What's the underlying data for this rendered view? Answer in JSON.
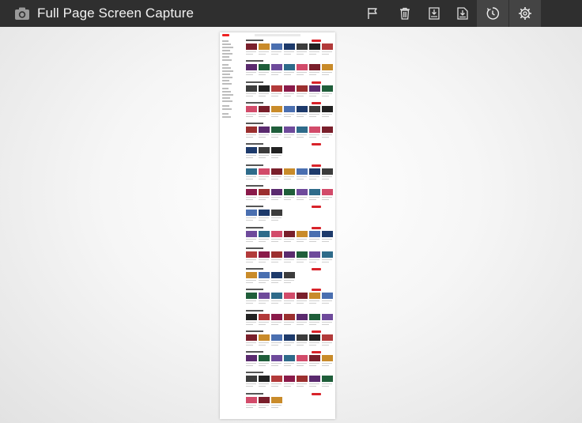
{
  "app": {
    "title": "Full Page Screen Capture",
    "icon": "camera-icon"
  },
  "toolbar": {
    "buttons": [
      {
        "name": "flag-icon"
      },
      {
        "name": "trash-icon"
      },
      {
        "name": "download-image-icon"
      },
      {
        "name": "download-pdf-icon"
      },
      {
        "name": "history-icon"
      },
      {
        "name": "settings-gear-icon"
      }
    ]
  },
  "colors": {
    "topbar": "#2f2f2f",
    "active_button": "#444444",
    "youtube_red": "#d8232a",
    "background": "#e8e8e8"
  },
  "preview": {
    "shelves": 18
  }
}
